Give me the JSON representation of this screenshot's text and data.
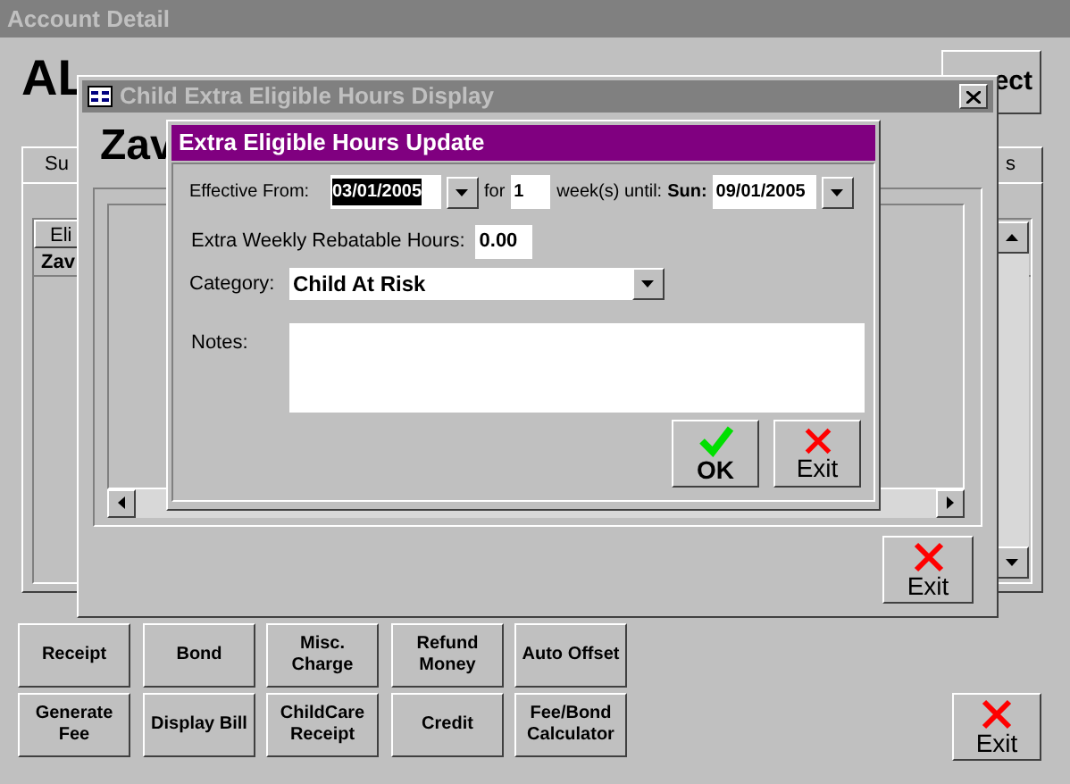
{
  "main_window": {
    "title": "Account Detail",
    "heading": "AL",
    "select_button": "ect",
    "tabs": [
      {
        "label": "Su",
        "selected": false
      },
      {
        "label": "s",
        "selected": false
      }
    ],
    "list": {
      "column": "Eli",
      "rows": [
        "Zav"
      ]
    },
    "buttons": [
      {
        "label": "Receipt"
      },
      {
        "label": "Bond"
      },
      {
        "label": "Misc. Charge"
      },
      {
        "label": "Refund Money"
      },
      {
        "label": "Auto Offset"
      },
      {
        "label": "Generate Fee"
      },
      {
        "label": "Display Bill"
      },
      {
        "label": "ChildCare Receipt"
      },
      {
        "label": "Credit"
      },
      {
        "label": "Fee/Bond Calculator"
      }
    ],
    "exit_button": "Exit"
  },
  "display_dialog": {
    "title": "Child Extra Eligible Hours Display",
    "heading": "Zav",
    "exit_button": "Exit"
  },
  "update_dialog": {
    "title": "Extra Eligible Hours Update",
    "effective_from_label": "Effective From:",
    "effective_from": {
      "value": "03/01/2005",
      "selected": true
    },
    "for_label": "for",
    "weeks": "1",
    "until_label": "week(s) until:",
    "until_day": "Sun:",
    "until_date": "09/01/2005",
    "hours_label": "Extra Weekly Rebatable Hours:",
    "hours": "0.00",
    "category_label": "Category:",
    "category": "Child At Risk",
    "notes_label": "Notes:",
    "ok_button": "OK",
    "exit_button": "Exit"
  }
}
